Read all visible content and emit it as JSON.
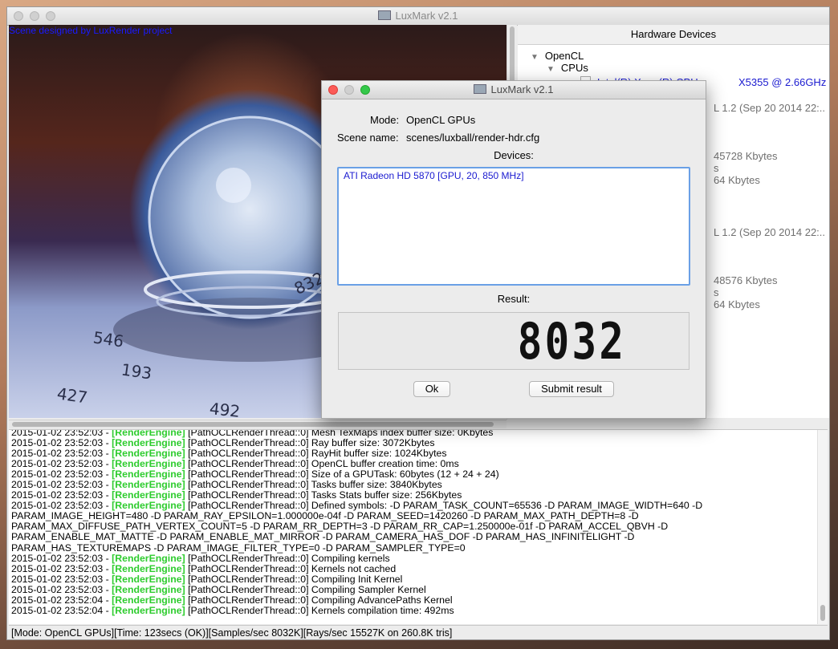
{
  "main_window": {
    "title": "LuxMark v2.1",
    "scene_credit": "Scene designed by LuxRender project",
    "scene_numbers": [
      "832",
      "546",
      "193",
      "427",
      "492"
    ]
  },
  "hardware_devices": {
    "header": "Hardware Devices",
    "opencl": "OpenCL",
    "cpus": "CPUs",
    "cpu_name": "Intel(R) Xeon(R) CPU",
    "cpu_model": "X5355  @ 2.66GHz",
    "peek_1": "L 1.2 (Sep 20 2014 22:..",
    "peek_2": "45728 Kbytes",
    "peek_3": "s",
    "peek_4": "64 Kbytes",
    "peek_5": "L 1.2 (Sep 20 2014 22:..",
    "peek_6": "48576 Kbytes",
    "peek_7": "s",
    "peek_8": "64 Kbytes"
  },
  "log": {
    "lines": [
      {
        "ts": "2015-01-02 23:52:03 - ",
        "tag": "[RenderEngine]",
        "msg": " [PathOCLRenderThread::0] Mesh TexMaps index buffer size: 0Kbytes"
      },
      {
        "ts": "2015-01-02 23:52:03 - ",
        "tag": "[RenderEngine]",
        "msg": " [PathOCLRenderThread::0] Ray buffer size: 3072Kbytes"
      },
      {
        "ts": "2015-01-02 23:52:03 - ",
        "tag": "[RenderEngine]",
        "msg": " [PathOCLRenderThread::0] RayHit buffer size: 1024Kbytes"
      },
      {
        "ts": "2015-01-02 23:52:03 - ",
        "tag": "[RenderEngine]",
        "msg": " [PathOCLRenderThread::0] OpenCL buffer creation time: 0ms"
      },
      {
        "ts": "2015-01-02 23:52:03 - ",
        "tag": "[RenderEngine]",
        "msg": " [PathOCLRenderThread::0] Size of a GPUTask: 60bytes (12 + 24 + 24)"
      },
      {
        "ts": "2015-01-02 23:52:03 - ",
        "tag": "[RenderEngine]",
        "msg": " [PathOCLRenderThread::0] Tasks buffer size: 3840Kbytes"
      },
      {
        "ts": "2015-01-02 23:52:03 - ",
        "tag": "[RenderEngine]",
        "msg": " [PathOCLRenderThread::0] Tasks Stats buffer size: 256Kbytes"
      },
      {
        "ts": "2015-01-02 23:52:03 - ",
        "tag": "[RenderEngine]",
        "msg": " [PathOCLRenderThread::0] Defined symbols: -D PARAM_TASK_COUNT=65536 -D PARAM_IMAGE_WIDTH=640 -D"
      },
      {
        "ts": "",
        "tag": "",
        "msg": "PARAM_IMAGE_HEIGHT=480 -D PARAM_RAY_EPSILON=1.000000e-04f -D PARAM_SEED=1420260 -D PARAM_MAX_PATH_DEPTH=8 -D"
      },
      {
        "ts": "",
        "tag": "",
        "msg": "PARAM_MAX_DIFFUSE_PATH_VERTEX_COUNT=5 -D PARAM_RR_DEPTH=3 -D PARAM_RR_CAP=1.250000e-01f -D PARAM_ACCEL_QBVH -D"
      },
      {
        "ts": "",
        "tag": "",
        "msg": "PARAM_ENABLE_MAT_MATTE -D PARAM_ENABLE_MAT_MIRROR -D PARAM_CAMERA_HAS_DOF -D PARAM_HAS_INFINITELIGHT -D"
      },
      {
        "ts": "",
        "tag": "",
        "msg": "PARAM_HAS_TEXTUREMAPS -D PARAM_IMAGE_FILTER_TYPE=0 -D PARAM_SAMPLER_TYPE=0"
      },
      {
        "ts": "2015-01-02 23:52:03 - ",
        "tag": "[RenderEngine]",
        "msg": " [PathOCLRenderThread::0] Compiling kernels"
      },
      {
        "ts": "2015-01-02 23:52:03 - ",
        "tag": "[RenderEngine]",
        "msg": " [PathOCLRenderThread::0] Kernels not cached"
      },
      {
        "ts": "2015-01-02 23:52:03 - ",
        "tag": "[RenderEngine]",
        "msg": " [PathOCLRenderThread::0] Compiling Init Kernel"
      },
      {
        "ts": "2015-01-02 23:52:03 - ",
        "tag": "[RenderEngine]",
        "msg": " [PathOCLRenderThread::0] Compiling Sampler Kernel"
      },
      {
        "ts": "2015-01-02 23:52:04 - ",
        "tag": "[RenderEngine]",
        "msg": " [PathOCLRenderThread::0] Compiling AdvancePaths Kernel"
      },
      {
        "ts": "2015-01-02 23:52:04 - ",
        "tag": "[RenderEngine]",
        "msg": " [PathOCLRenderThread::0] Kernels compilation time: 492ms"
      }
    ]
  },
  "status_bar": "[Mode: OpenCL GPUs][Time: 123secs (OK)][Samples/sec   8032K][Rays/sec   15527K on 260.8K tris]",
  "dialog": {
    "title": "LuxMark v2.1",
    "mode_label": "Mode:",
    "mode_value": "OpenCL GPUs",
    "scene_label": "Scene name:",
    "scene_value": "scenes/luxball/render-hdr.cfg",
    "devices_label": "Devices:",
    "devices": [
      "ATI Radeon HD 5870 [GPU, 20, 850 MHz]"
    ],
    "result_label": "Result:",
    "result_value": "8032",
    "ok_label": "Ok",
    "submit_label": "Submit result"
  },
  "colors": {
    "log_tag": "#2ecc2e",
    "device_text": "#1a1ad0",
    "list_focus": "#6aa0e6",
    "close_button": "#fc5b57",
    "zoom_button": "#34c84a"
  }
}
